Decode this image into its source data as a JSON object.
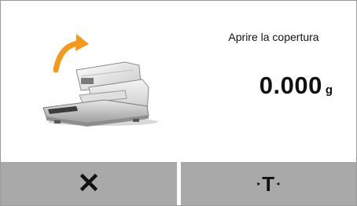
{
  "display": {
    "message": "Aprire la copertura",
    "weight_value": "0.000",
    "weight_unit": "g",
    "illustration_icon": "balance-open-cover-icon",
    "arrow_color": "#f39a1e"
  },
  "softkeys": {
    "cancel_icon": "close-icon",
    "tare_label": "T",
    "tare_left_marker": "▸",
    "tare_right_marker": "◂",
    "background_color": "#a9a9a9"
  }
}
